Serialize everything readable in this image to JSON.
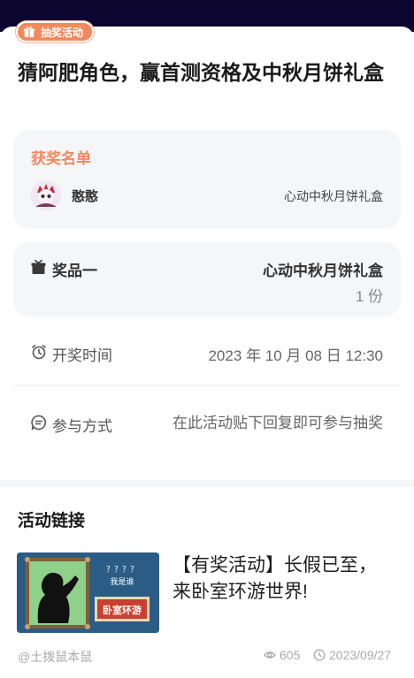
{
  "tag": {
    "label": "抽奖活动",
    "icon": "gift-icon",
    "color": "#f2895c"
  },
  "title": "猜阿肥角色，赢首测资格及中秋月饼礼盒",
  "winners": {
    "heading": "获奖名单",
    "user": "憨憨",
    "prize": "心动中秋月饼礼盒"
  },
  "prize": {
    "label": "奖品一",
    "name": "心动中秋月饼礼盒",
    "count": "1 份",
    "icon": "gift-icon"
  },
  "draw_time": {
    "label": "开奖时间",
    "value": "2023 年 10 月 08 日 12:30",
    "icon": "alarm-clock-icon"
  },
  "join_method": {
    "label": "参与方式",
    "value": "在此活动贴下回复即可参与抽奖",
    "icon": "chat-bubble-icon"
  },
  "links": {
    "title": "活动链接",
    "item_text": "【有奖活动】长假已至，来卧室环游世界!",
    "thumb_caption": "？？？？",
    "thumb_subcaption": "我是谁",
    "thumb_badge": "卧室环游"
  },
  "footer": {
    "author": "@土拨鼠本鼠",
    "views": "605",
    "date": "2023/09/27",
    "views_icon": "eye-icon",
    "date_icon": "clock-icon"
  }
}
